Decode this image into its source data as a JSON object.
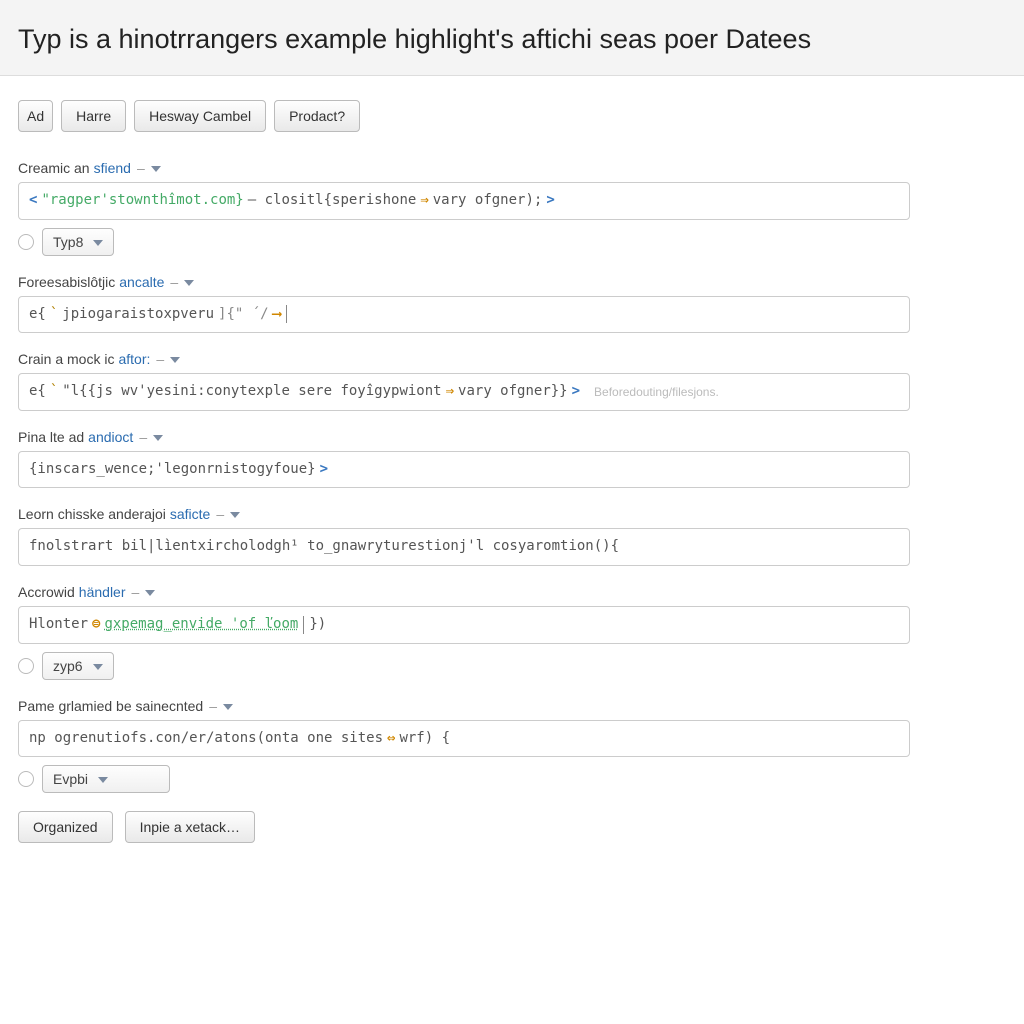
{
  "header": {
    "title": "Typ is a hinotrrangers example highlight's aftichi seas poer Datees"
  },
  "toolbar": {
    "btn_ad": "Ad",
    "btn_harre": "Harre",
    "btn_hesway": "Hesway Cambel",
    "btn_prodact": "Prodact?"
  },
  "fields": {
    "f1": {
      "label_a": "Creamic an",
      "label_b": "sfiend",
      "code_pre": "<",
      "code_str": "\"ragper'stownthîmot.com}",
      "code_mid": " — clositl{sperishone ",
      "code_arrow": "⇒",
      "code_post": " vary ofgner);",
      "code_gt": ">",
      "select": "Typ8"
    },
    "f2": {
      "label_a": "Foreesabislôtjic",
      "label_b": "ancalte",
      "code_a": "e{",
      "code_b": "`",
      "code_c": "jpioɡaraistoxpveru",
      "code_d": "]{\" ´/ ",
      "code_arrow": "⟶"
    },
    "f3": {
      "label_a": "Crain a mock ic",
      "label_b": "aftor:",
      "code_a": "e{",
      "code_b": "`",
      "code_c": "\"l{{js wv'yesini:conytexple sere foyîgypwiont ",
      "code_arrow": "⇒",
      "code_d": " vary ofgner}}",
      "code_gt": ">",
      "hint": "Beforedouting/filesjons."
    },
    "f4": {
      "label_a": "Pina lte ad",
      "label_b": "andioct",
      "code_a": "{inscars_wence;'legonrnistogyfoue}",
      "code_gt": " >"
    },
    "f5": {
      "label_a": "Leorn chisske anderajoi",
      "label_b": "saficte",
      "code_a": "fnolstrart bil|lìentxircholodgh¹ to_gnawryturestionj'l cosyaromtion(){"
    },
    "f6": {
      "label_a": "Accrowid",
      "label_b": "händler",
      "code_a": "Hlonter ",
      "code_eq": "⊜",
      "code_b": " gxpemag_envide 'of ľoom ",
      "code_c": "})",
      "select": "zyp6"
    },
    "f7": {
      "label_a": "Pame grlamied be sainecnted",
      "code_a": "np ogrenutiofs.con/er/atons(onta one sites ",
      "code_arrow": "⇔",
      "code_b": " wrf) {",
      "select": "Evpbi"
    }
  },
  "footer": {
    "btn_organized": "Organized",
    "btn_inpie": "Inpie a xetack…"
  }
}
